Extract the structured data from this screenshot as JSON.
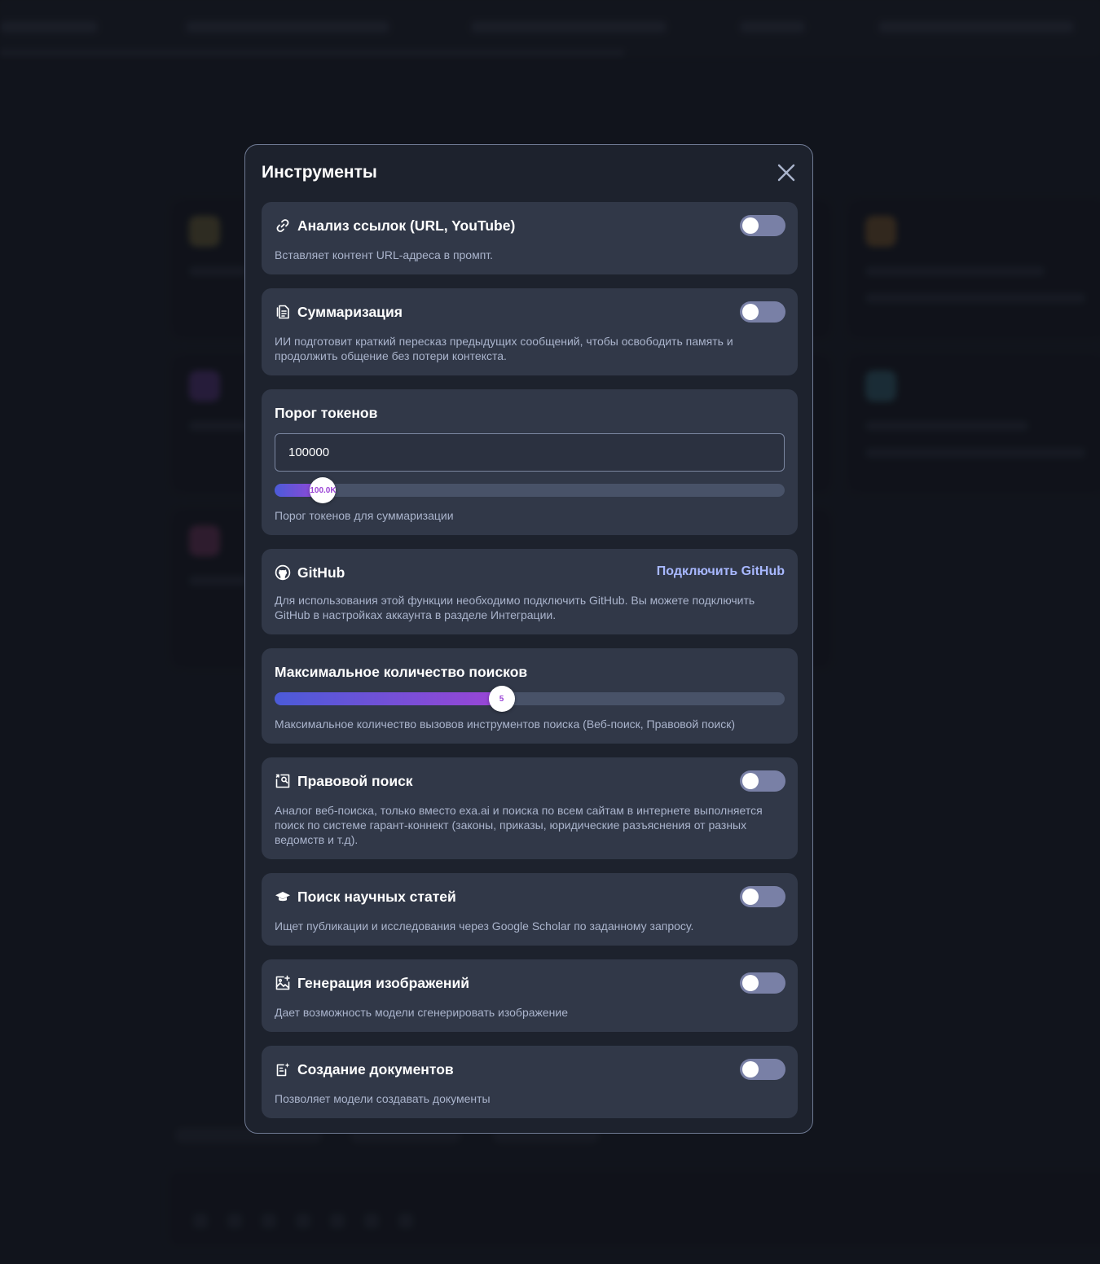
{
  "modal": {
    "title": "Инструменты"
  },
  "tools": {
    "url_analysis": {
      "title": "Анализ ссылок (URL, YouTube)",
      "description": "Вставляет контент URL-адреса в промпт.",
      "enabled": false
    },
    "summarization": {
      "title": "Суммаризация",
      "description": "ИИ подготовит краткий пересказ предыдущих сообщений, чтобы освободить память и продолжить общение без потери контекста.",
      "enabled": false
    },
    "token_threshold": {
      "title": "Порог токенов",
      "input_value": "100000",
      "slider_label": "100.0K",
      "slider_fraction": 0.095,
      "description": "Порог токенов для суммаризации"
    },
    "github": {
      "title": "GitHub",
      "connect_label": "Подключить GitHub",
      "description": "Для использования этой функции необходимо подключить GitHub. Вы можете подключить GitHub в настройках аккаунта в разделе Интеграции."
    },
    "max_searches": {
      "title": "Максимальное количество поисков",
      "slider_label": "5",
      "slider_fraction": 0.445,
      "description": "Максимальное количество вызовов инструментов поиска (Веб-поиск, Правовой поиск)"
    },
    "legal_search": {
      "title": "Правовой поиск",
      "description": "Аналог веб-поиска, только вместо exa.ai и поиска по всем сайтам в интернете выполняется поиск по системе гарант-коннект (законы, приказы, юридические разъяснения от разных ведомств и т.д).",
      "enabled": false
    },
    "scholar_search": {
      "title": "Поиск научных статей",
      "description": "Ищет публикации и исследования через Google Scholar по заданному запросу.",
      "enabled": false
    },
    "image_generation": {
      "title": "Генерация изображений",
      "description": "Дает возможность модели сгенерировать изображение",
      "enabled": false
    },
    "document_creation": {
      "title": "Создание документов",
      "description": "Позволяет модели создавать документы",
      "enabled": false
    }
  },
  "colors": {
    "accent_start": "#4b5bd8",
    "accent_end": "#9b45d6",
    "toggle_off": "#7980a6",
    "link": "#a8b8ff"
  },
  "icons": [
    "link-icon",
    "summary-document-icon",
    "github-icon",
    "legal-search-icon",
    "graduation-cap-icon",
    "image-generate-icon",
    "document-create-icon",
    "close-icon"
  ]
}
